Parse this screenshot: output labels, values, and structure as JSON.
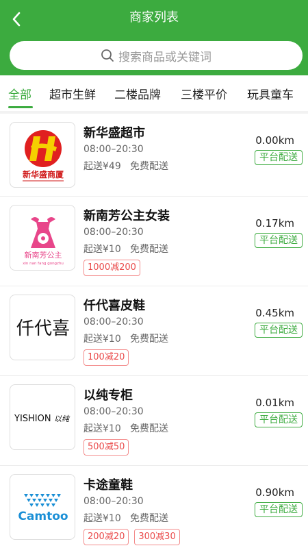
{
  "header": {
    "title": "商家列表",
    "back_icon": "chevron-left-icon"
  },
  "search": {
    "placeholder": "搜索商品或关键词",
    "icon": "search-icon"
  },
  "tabs": [
    {
      "label": "全部",
      "active": true
    },
    {
      "label": "超市生鲜",
      "active": false
    },
    {
      "label": "二楼品牌",
      "active": false
    },
    {
      "label": "三楼平价",
      "active": false
    },
    {
      "label": "玩具童车",
      "active": false
    }
  ],
  "stores": [
    {
      "name": "新华盛超市",
      "hours": "08:00–20:30",
      "min_order": "起送¥49",
      "delivery": "免费配送",
      "distance": "0.00km",
      "platform": "平台配送",
      "promos": [],
      "logo": {
        "type": "xinhuasheng",
        "caption": "新华盛商厦"
      }
    },
    {
      "name": "新南芳公主女装",
      "hours": "08:00–20:30",
      "min_order": "起送¥10",
      "delivery": "免费配送",
      "distance": "0.17km",
      "platform": "平台配送",
      "promos": [
        "1000减200"
      ],
      "logo": {
        "type": "princess",
        "caption": "新南芳公主",
        "subcaption": "xin nan fang gongzhu"
      }
    },
    {
      "name": "仟代喜皮鞋",
      "hours": "08:00–20:30",
      "min_order": "起送¥10",
      "delivery": "免费配送",
      "distance": "0.45km",
      "platform": "平台配送",
      "promos": [
        "100减20"
      ],
      "logo": {
        "type": "text",
        "text": "仟代喜"
      }
    },
    {
      "name": "以纯专柜",
      "hours": "08:00–20:30",
      "min_order": "起送¥10",
      "delivery": "免费配送",
      "distance": "0.01km",
      "platform": "平台配送",
      "promos": [
        "500减50"
      ],
      "logo": {
        "type": "yishion",
        "text": "YISHION",
        "text2": "以纯"
      }
    },
    {
      "name": "卡途童鞋",
      "hours": "08:00–20:30",
      "min_order": "起送¥10",
      "delivery": "免费配送",
      "distance": "0.90km",
      "platform": "平台配送",
      "promos": [
        "200减20",
        "300减30"
      ],
      "logo": {
        "type": "camtoo",
        "text": "Camtoo"
      }
    }
  ],
  "colors": {
    "brand": "#3cab3f",
    "promo": "#ea4b4b",
    "muted": "#666666"
  }
}
